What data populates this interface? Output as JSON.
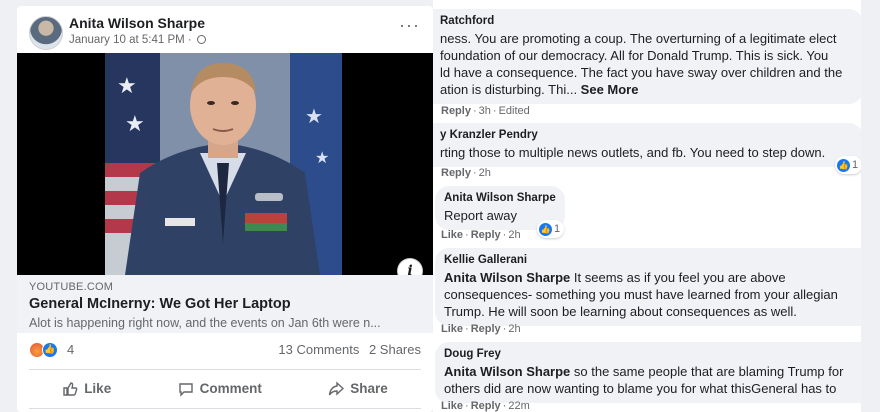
{
  "post": {
    "author": "Anita Wilson Sharpe",
    "timestamp": "January 10 at 5:41 PM ·",
    "link": {
      "domain": "YOUTUBE.COM",
      "title": "General McInerny: We Got Her Laptop",
      "description": "Alot is happening right now, and the events on Jan 6th were n..."
    },
    "reaction_count": "4",
    "comments_count": "13 Comments",
    "shares_count": "2 Shares",
    "actions": {
      "like": "Like",
      "comment": "Comment",
      "share": "Share"
    }
  },
  "comments": [
    {
      "name": "Ratchford",
      "lines": [
        "ness. You are promoting a coup. The overturning of a legitimate elect",
        "foundation of our democracy. All for Donald Trump. This is sick. You",
        "ld have a consequence. The fact you have sway over children and the",
        "ation is disturbing. Thi... "
      ],
      "see_more": "See More",
      "reply": "Reply",
      "time": "3h",
      "edited": "Edited"
    },
    {
      "name": "y Kranzler Pendry",
      "lines": [
        "rting those to multiple news outlets, and fb. You need to step down."
      ],
      "reply": "Reply",
      "time": "2h",
      "like_count": "1"
    },
    {
      "name": "Anita Wilson Sharpe",
      "lines": [
        "Report away"
      ],
      "like": "Like",
      "reply": "Reply",
      "time": "2h",
      "like_count": "1"
    },
    {
      "name": "Kellie Gallerani",
      "tag": "Anita Wilson Sharpe",
      "first_line": " It seems as if you feel you are above",
      "lines": [
        "consequences- something you must have learned from your allegian",
        "Trump. He will soon be learning about consequences as well."
      ],
      "like": "Like",
      "reply": "Reply",
      "time": "2h"
    },
    {
      "name": "Doug Frey",
      "tag": "Anita Wilson Sharpe",
      "first_line": " so the same people that are blaming Trump for",
      "lines": [
        "others did are now wanting to blame you for what thisGeneral has to"
      ],
      "like": "Like",
      "reply": "Reply",
      "time": "22m"
    }
  ],
  "colors": {
    "facebook_blue": "#1877f2",
    "secondary_text": "#65676b",
    "bubble": "#f0f2f5"
  }
}
